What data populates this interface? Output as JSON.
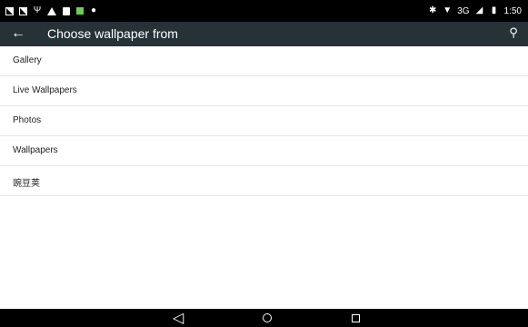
{
  "status": {
    "network": "3G",
    "time": "1:50"
  },
  "toolbar": {
    "title": "Choose wallpaper from"
  },
  "list": [
    {
      "label": "Gallery"
    },
    {
      "label": "Live Wallpapers"
    },
    {
      "label": "Photos"
    },
    {
      "label": "Wallpapers"
    },
    {
      "label": "豌豆荚"
    }
  ],
  "icons": {
    "back": "arrow-left",
    "search": "magnifier",
    "nav": [
      "back-triangle",
      "home-circle",
      "recent-square"
    ]
  },
  "colors": {
    "toolbar": "#263238",
    "status_bar": "#000000",
    "nav_bar": "#000000"
  }
}
